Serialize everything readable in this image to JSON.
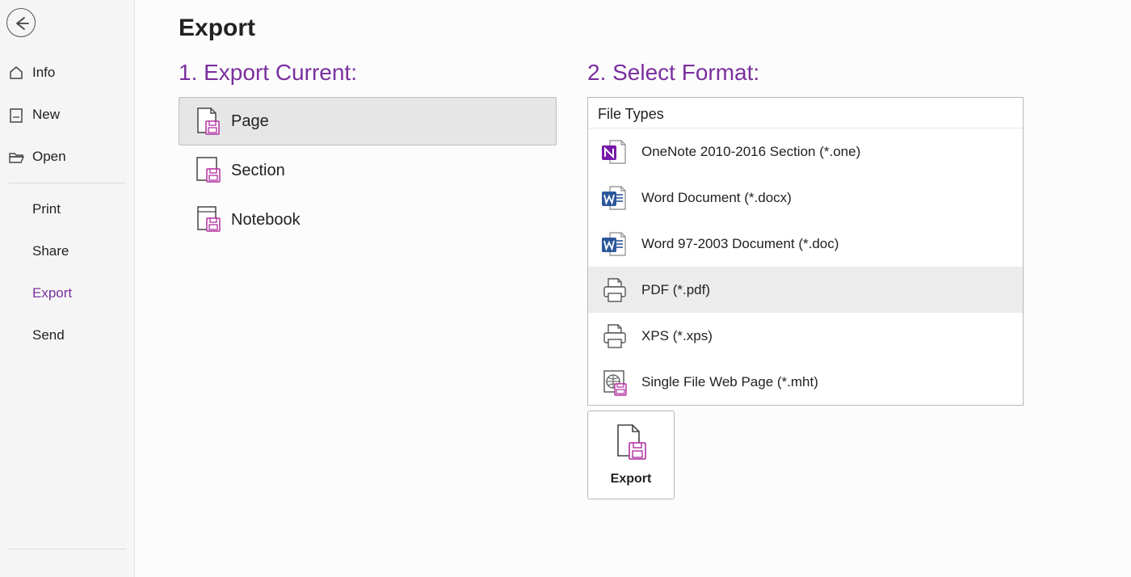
{
  "sidebar": {
    "back_label": "Back",
    "items": [
      {
        "label": "Info",
        "icon": "home-icon",
        "selected": false
      },
      {
        "label": "New",
        "icon": "file-icon",
        "selected": false
      },
      {
        "label": "Open",
        "icon": "folder-icon",
        "selected": false
      }
    ],
    "items2": [
      {
        "label": "Print",
        "selected": false
      },
      {
        "label": "Share",
        "selected": false
      },
      {
        "label": "Export",
        "selected": true
      },
      {
        "label": "Send",
        "selected": false
      }
    ]
  },
  "main": {
    "title": "Export",
    "scope_heading": "1. Export Current:",
    "scopes": [
      {
        "label": "Page",
        "selected": true
      },
      {
        "label": "Section",
        "selected": false
      },
      {
        "label": "Notebook",
        "selected": false
      }
    ],
    "format_heading": "2. Select Format:",
    "file_types_label": "File Types",
    "formats": [
      {
        "label": "OneNote 2010-2016 Section (*.one)",
        "icon": "onenote-icon",
        "selected": false
      },
      {
        "label": "Word Document (*.docx)",
        "icon": "word-icon",
        "selected": false
      },
      {
        "label": "Word 97-2003 Document (*.doc)",
        "icon": "word-old-icon",
        "selected": false
      },
      {
        "label": "PDF (*.pdf)",
        "icon": "printer-icon",
        "selected": true
      },
      {
        "label": "XPS (*.xps)",
        "icon": "printer-icon",
        "selected": false
      },
      {
        "label": "Single File Web Page (*.mht)",
        "icon": "webpage-icon",
        "selected": false
      }
    ],
    "export_button_label": "Export"
  },
  "colors": {
    "accent": "#7a2f9e",
    "magenta": "#b02fa0"
  }
}
